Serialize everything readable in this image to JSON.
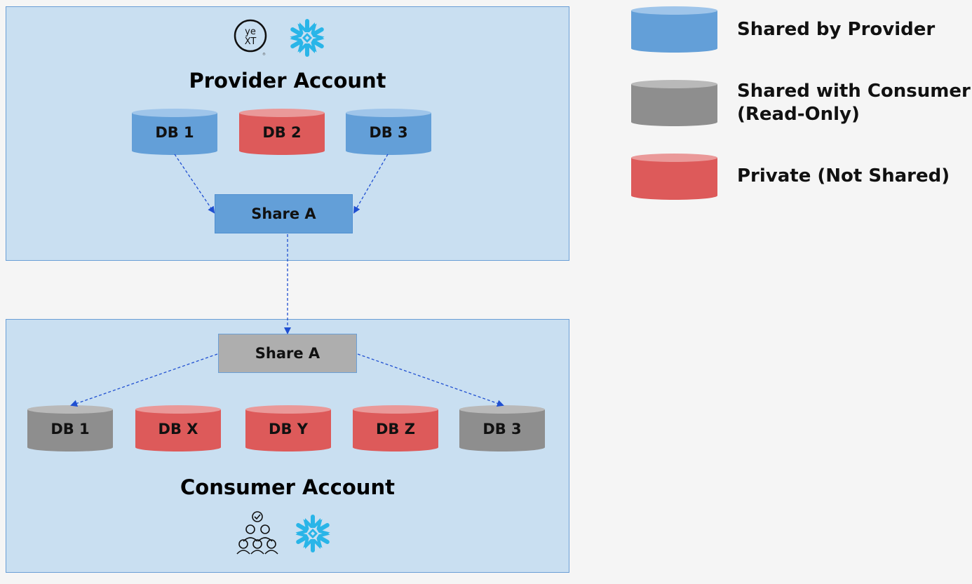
{
  "provider": {
    "title": "Provider Account",
    "logos": [
      "yext-logo",
      "snowflake-logo"
    ],
    "databases": [
      {
        "label": "DB 1",
        "type": "shared-by-provider"
      },
      {
        "label": "DB 2",
        "type": "private"
      },
      {
        "label": "DB 3",
        "type": "shared-by-provider"
      }
    ],
    "share": {
      "label": "Share A"
    }
  },
  "consumer": {
    "title": "Consumer Account",
    "icons": [
      "users-group-icon",
      "snowflake-logo"
    ],
    "share": {
      "label": "Share A"
    },
    "databases": [
      {
        "label": "DB 1",
        "type": "shared-with-consumer"
      },
      {
        "label": "DB X",
        "type": "private"
      },
      {
        "label": "DB Y",
        "type": "private"
      },
      {
        "label": "DB Z",
        "type": "private"
      },
      {
        "label": "DB 3",
        "type": "shared-with-consumer"
      }
    ]
  },
  "edges": [
    {
      "from": "provider.DB 1",
      "to": "provider.Share A",
      "style": "dashed"
    },
    {
      "from": "provider.DB 3",
      "to": "provider.Share A",
      "style": "dashed"
    },
    {
      "from": "provider.Share A",
      "to": "consumer.Share A",
      "style": "dashed"
    },
    {
      "from": "consumer.Share A",
      "to": "consumer.DB 1",
      "style": "dashed"
    },
    {
      "from": "consumer.Share A",
      "to": "consumer.DB 3",
      "style": "dashed"
    }
  ],
  "legend": [
    {
      "label": "Shared  by Provider",
      "color": "#639fd8"
    },
    {
      "label_line1": "Shared with Consumer",
      "label_line2": "(Read-Only)",
      "color": "#8e8e8e"
    },
    {
      "label": "Private (Not Shared)",
      "color": "#dd5a5a"
    }
  ],
  "colors": {
    "panel_bg": "#c9dff1",
    "arrow": "#1f4fd1",
    "shared_by_provider": "#639fd8",
    "shared_with_consumer": "#8e8e8e",
    "private": "#dd5a5a"
  }
}
